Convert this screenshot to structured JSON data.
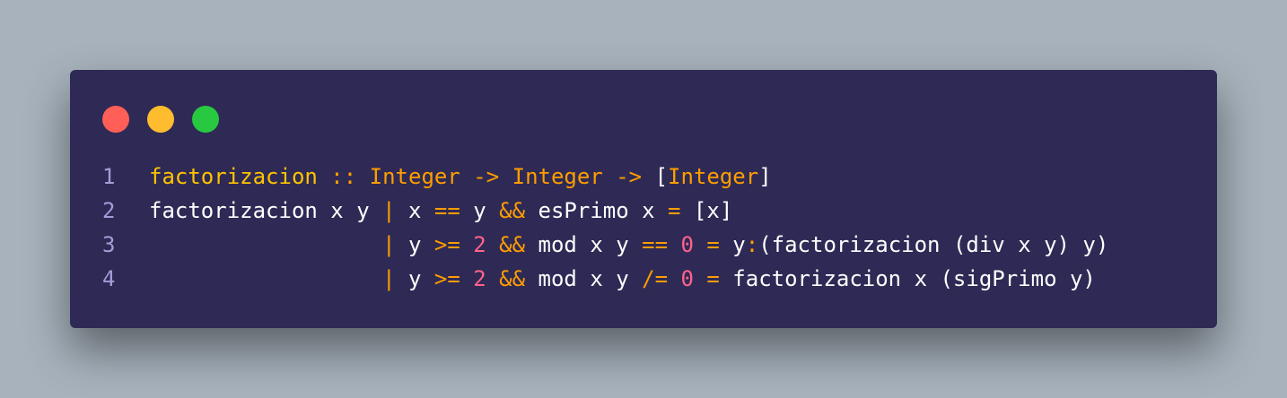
{
  "colors": {
    "page_background": "#a7b2bc",
    "window_background": "#2e2a55",
    "dot_close": "#ff5f57",
    "dot_minimize": "#febc2e",
    "dot_maximize": "#28c840",
    "line_number": "#a39dd8",
    "function_name": "#ffc400",
    "keyword_operator": "#ff9d00",
    "number": "#ff628c",
    "identifier": "#ffffff"
  },
  "window_controls": [
    {
      "name": "close-dot",
      "color": "#ff5f57"
    },
    {
      "name": "minimize-dot",
      "color": "#febc2e"
    },
    {
      "name": "maximize-dot",
      "color": "#28c840"
    }
  ],
  "code_lines": [
    {
      "number": "1",
      "tokens": [
        {
          "t": "factorizacion",
          "k": "fn"
        },
        {
          "t": " ",
          "k": "id"
        },
        {
          "t": "::",
          "k": "op"
        },
        {
          "t": " ",
          "k": "id"
        },
        {
          "t": "Integer",
          "k": "kw"
        },
        {
          "t": " ",
          "k": "id"
        },
        {
          "t": "->",
          "k": "op"
        },
        {
          "t": " ",
          "k": "id"
        },
        {
          "t": "Integer",
          "k": "kw"
        },
        {
          "t": " ",
          "k": "id"
        },
        {
          "t": "->",
          "k": "op"
        },
        {
          "t": " [",
          "k": "id"
        },
        {
          "t": "Integer",
          "k": "kw"
        },
        {
          "t": "]",
          "k": "id"
        }
      ]
    },
    {
      "number": "2",
      "tokens": [
        {
          "t": "factorizacion x y ",
          "k": "id"
        },
        {
          "t": "|",
          "k": "op"
        },
        {
          "t": " x ",
          "k": "id"
        },
        {
          "t": "==",
          "k": "op"
        },
        {
          "t": " y ",
          "k": "id"
        },
        {
          "t": "&&",
          "k": "op"
        },
        {
          "t": " esPrimo x ",
          "k": "id"
        },
        {
          "t": "=",
          "k": "op"
        },
        {
          "t": " [x]",
          "k": "id"
        }
      ]
    },
    {
      "number": "3",
      "tokens": [
        {
          "t": "                  ",
          "k": "id"
        },
        {
          "t": "|",
          "k": "op"
        },
        {
          "t": " y ",
          "k": "id"
        },
        {
          "t": ">=",
          "k": "op"
        },
        {
          "t": " ",
          "k": "id"
        },
        {
          "t": "2",
          "k": "num"
        },
        {
          "t": " ",
          "k": "id"
        },
        {
          "t": "&&",
          "k": "op"
        },
        {
          "t": " mod x y ",
          "k": "id"
        },
        {
          "t": "==",
          "k": "op"
        },
        {
          "t": " ",
          "k": "id"
        },
        {
          "t": "0",
          "k": "num"
        },
        {
          "t": " ",
          "k": "id"
        },
        {
          "t": "=",
          "k": "op"
        },
        {
          "t": " y",
          "k": "id"
        },
        {
          "t": ":",
          "k": "op"
        },
        {
          "t": "(factorizacion (div x y) y)",
          "k": "id"
        }
      ]
    },
    {
      "number": "4",
      "tokens": [
        {
          "t": "                  ",
          "k": "id"
        },
        {
          "t": "|",
          "k": "op"
        },
        {
          "t": " y ",
          "k": "id"
        },
        {
          "t": ">=",
          "k": "op"
        },
        {
          "t": " ",
          "k": "id"
        },
        {
          "t": "2",
          "k": "num"
        },
        {
          "t": " ",
          "k": "id"
        },
        {
          "t": "&&",
          "k": "op"
        },
        {
          "t": " mod x y ",
          "k": "id"
        },
        {
          "t": "/=",
          "k": "op"
        },
        {
          "t": " ",
          "k": "id"
        },
        {
          "t": "0",
          "k": "num"
        },
        {
          "t": " ",
          "k": "id"
        },
        {
          "t": "=",
          "k": "op"
        },
        {
          "t": " factorizacion x (sigPrimo y)",
          "k": "id"
        }
      ]
    }
  ]
}
